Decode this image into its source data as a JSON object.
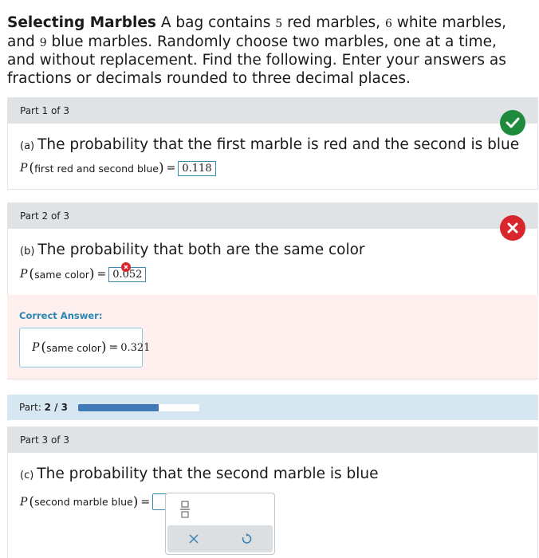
{
  "problem": {
    "title": "Selecting Marbles",
    "text_a": "A bag contains",
    "n_red": "5",
    "text_b": "red marbles,",
    "n_white": "6",
    "text_c": "white marbles, and",
    "n_blue": "9",
    "text_d": "blue marbles. Randomly choose two marbles, one at a time, and without replacement. Find the following. Enter your answers as fractions or decimals rounded to three decimal places."
  },
  "parts": [
    {
      "header": "Part 1 of 3",
      "letter": "(a)",
      "question": "The probability that the first marble is red and the second is blue",
      "formula_symbol": "P",
      "formula_arg": "first red and second blue",
      "equals": "=",
      "answer": "0.118",
      "status": "correct"
    },
    {
      "header": "Part 2 of 3",
      "letter": "(b)",
      "question": "The probability that both are the same color",
      "formula_symbol": "P",
      "formula_arg": "same color",
      "equals": "=",
      "answer": "0.052",
      "status": "incorrect"
    },
    {
      "header": "Part 3 of 3",
      "letter": "(c)",
      "question": "The probability that the second marble is blue",
      "formula_symbol": "P",
      "formula_arg": "second marble blue",
      "equals": "=",
      "answer": ""
    }
  ],
  "correct_answer": {
    "label": "Correct Answer:",
    "formula_symbol": "P",
    "formula_arg": "same color",
    "equals": "=",
    "value": "0.321"
  },
  "progress": {
    "label": "Part:",
    "current": "2 / 3",
    "fraction": 0.667
  },
  "colors": {
    "correct": "#1e8a3c",
    "incorrect": "#d9262c",
    "accent": "#2a86b2",
    "progress_fill": "#3f79b8"
  },
  "icons": [
    "checkmark-icon",
    "x-mark-icon",
    "fraction-icon",
    "clear-icon",
    "undo-icon"
  ]
}
